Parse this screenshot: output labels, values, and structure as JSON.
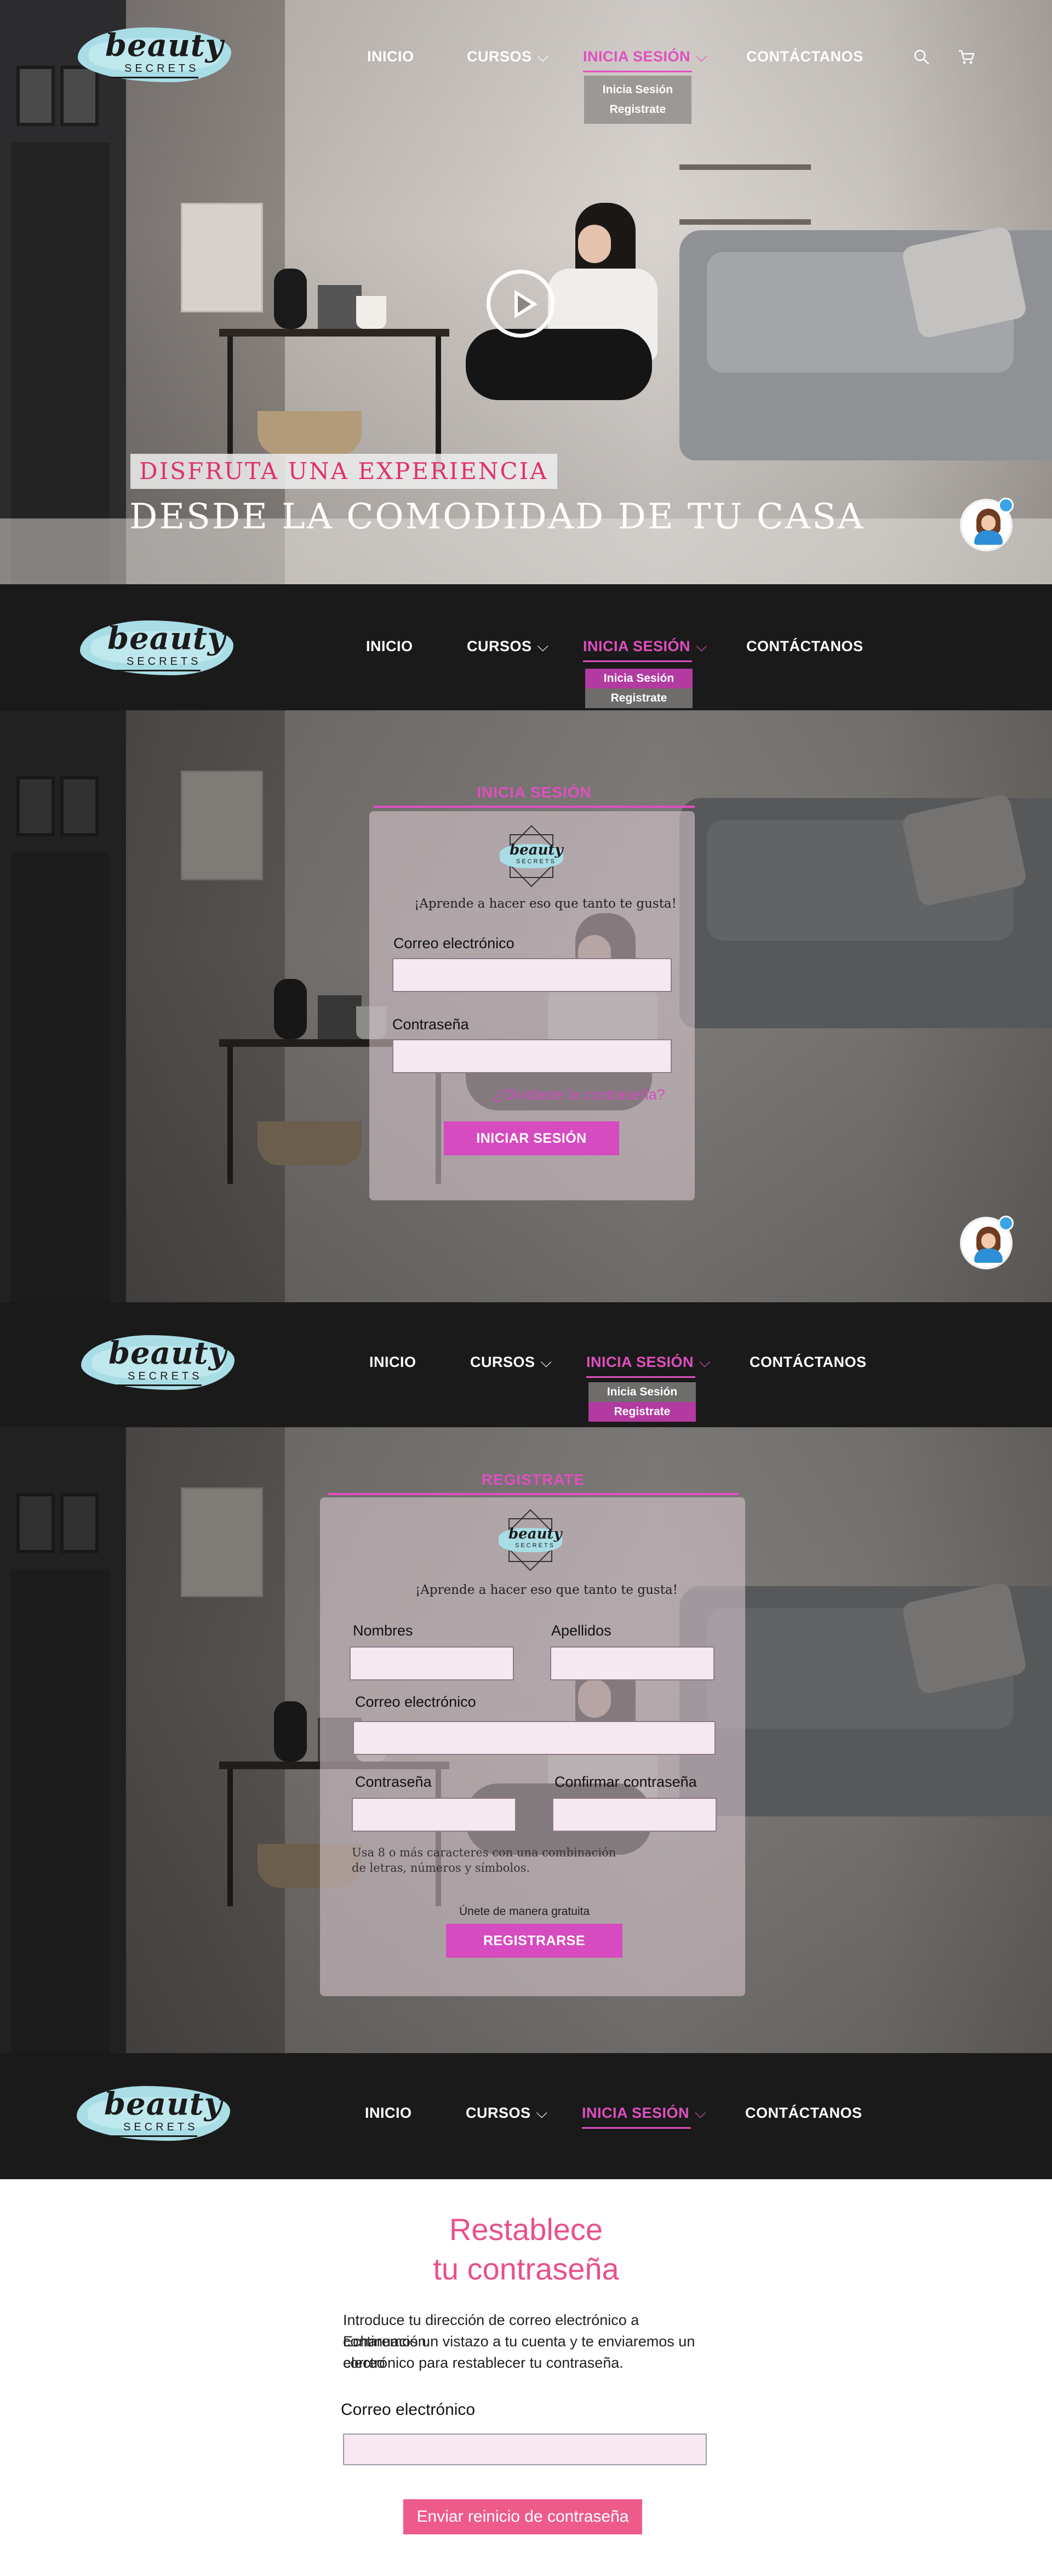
{
  "brand": {
    "logo_word": "beauty",
    "logo_sub": "SECRETS"
  },
  "nav": {
    "inicio": "INICIO",
    "cursos": "CURSOS",
    "inicia_sesion": "INICIA SESIÓN",
    "contactanos": "CONTÁCTANOS",
    "chevron": "⌵",
    "dropdown": {
      "login": "Inicia Sesión",
      "register": "Registrate"
    }
  },
  "hero": {
    "tagline": "DISFRUTA UNA EXPERIENCIA",
    "title": "DESDE LA COMODIDAD DE TU CASA"
  },
  "login": {
    "tab": "INICIA SESIÓN",
    "logo_word": "beauty",
    "logo_sub": "SECRETS",
    "subtitle": "¡Aprende a hacer eso que tanto te gusta!",
    "email_label": "Correo electrónico",
    "password_label": "Contraseña",
    "forgot": "¿Olvidaste la contraseña?",
    "submit": "INICIAR SESIÓN"
  },
  "register": {
    "tab": "REGISTRATE",
    "logo_word": "beauty",
    "logo_sub": "SECRETS",
    "subtitle": "¡Aprende a hacer eso que tanto te gusta!",
    "names_label": "Nombres",
    "surnames_label": "Apellidos",
    "email_label": "Correo electrónico",
    "password_label": "Contraseña",
    "confirm_label": "Confirmar contraseña",
    "hint_line1": "Usa 8 o más caracteres con una combinación",
    "hint_line2": "de letras, números y símbolos.",
    "free": "Únete de manera gratuita",
    "submit": "REGISTRARSE"
  },
  "reset": {
    "title_line1": "Restablece",
    "title_line2": "tu contraseña",
    "desc_line1": "Introduce tu dirección de correo electrónico a continuación.",
    "desc_line2": "Echaremos un vistazo a tu cuenta y te enviaremos un correo",
    "desc_line3": "electrónico para restablecer tu contraseña.",
    "email_label": "Correo electrónico",
    "submit": "Enviar reinicio de contraseña"
  },
  "colors": {
    "accent": "#e04fbf",
    "reset_accent": "#ee5b8b",
    "nav_bg": "#1a1a1a",
    "logo_blob": "#a8dde6"
  },
  "icons": [
    "search-icon",
    "cart-icon",
    "play-icon",
    "chat-avatar-icon",
    "chevron-down-icon"
  ]
}
